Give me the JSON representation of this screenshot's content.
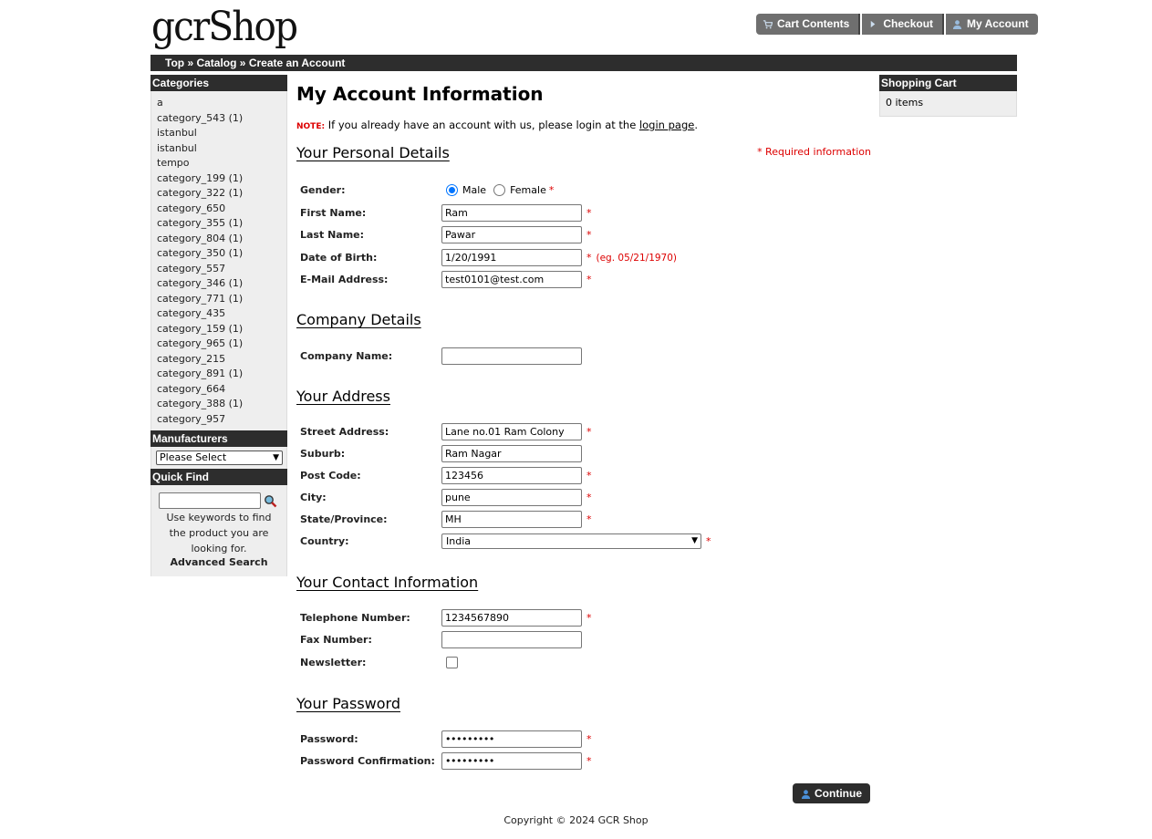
{
  "header": {
    "logo": "gcrShop",
    "nav": [
      {
        "label": "Cart Contents",
        "icon": "cart-icon"
      },
      {
        "label": "Checkout",
        "icon": "arrow-icon"
      },
      {
        "label": "My Account",
        "icon": "user-icon"
      }
    ]
  },
  "breadcrumb": [
    "Top",
    "Catalog",
    "Create an Account"
  ],
  "breadcrumb_sep": " » ",
  "left": {
    "categories_title": "Categories",
    "categories": [
      "a",
      "category_543 (1)",
      "istanbul",
      "istanbul",
      "tempo",
      "category_199 (1)",
      "category_322 (1)",
      "category_650",
      "category_355 (1)",
      "category_804 (1)",
      "category_350 (1)",
      "category_557",
      "category_346 (1)",
      "category_771 (1)",
      "category_435",
      "category_159 (1)",
      "category_965 (1)",
      "category_215",
      "category_891 (1)",
      "category_664",
      "category_388 (1)",
      "category_957"
    ],
    "manufacturers_title": "Manufacturers",
    "manufacturers_selected": "Please Select",
    "quickfind_title": "Quick Find",
    "quickfind_help": "Use keywords to find the product you are looking for.",
    "advanced_search": "Advanced Search"
  },
  "right": {
    "cart_title": "Shopping Cart",
    "cart_items": "0 items"
  },
  "main": {
    "title": "My Account Information",
    "note_label": "NOTE:",
    "note_text": " If you already have an account with us, please login at the ",
    "note_link": "login page",
    "note_end": ".",
    "required_info": "* Required information",
    "sections": {
      "personal": "Your Personal Details",
      "company": "Company Details",
      "address": "Your Address",
      "contact": "Your Contact Information",
      "password": "Your Password"
    },
    "gender_label": "Gender:",
    "gender_male": "Male",
    "gender_female": "Female",
    "gender_selected": "Male",
    "fields": {
      "first_name": {
        "label": "First Name:",
        "value": "Ram"
      },
      "last_name": {
        "label": "Last Name:",
        "value": "Pawar"
      },
      "dob": {
        "label": "Date of Birth:",
        "value": "1/20/1991",
        "hint": "(eg. 05/21/1970)"
      },
      "email": {
        "label": "E-Mail Address:",
        "value": "test0101@test.com"
      },
      "company": {
        "label": "Company Name:",
        "value": ""
      },
      "street": {
        "label": "Street Address:",
        "value": "Lane no.01 Ram Colony"
      },
      "suburb": {
        "label": "Suburb:",
        "value": "Ram Nagar"
      },
      "postcode": {
        "label": "Post Code:",
        "value": "123456"
      },
      "city": {
        "label": "City:",
        "value": "pune"
      },
      "state": {
        "label": "State/Province:",
        "value": "MH"
      },
      "country": {
        "label": "Country:",
        "value": "India"
      },
      "telephone": {
        "label": "Telephone Number:",
        "value": "1234567890"
      },
      "fax": {
        "label": "Fax Number:",
        "value": ""
      },
      "newsletter": {
        "label": "Newsletter:",
        "checked": false
      },
      "password": {
        "label": "Password:",
        "value": "•••••••••"
      },
      "password_confirm": {
        "label": "Password Confirmation:",
        "value": "•••••••••"
      }
    },
    "req_mark": "*",
    "continue": "Continue"
  },
  "footer": "Copyright © 2024 GCR Shop",
  "colors": {
    "dark_bar": "#2d2d2d",
    "nav_button": "#6f6f6f",
    "required": "#dd0000",
    "sidebar_bg": "#eeeeee"
  }
}
